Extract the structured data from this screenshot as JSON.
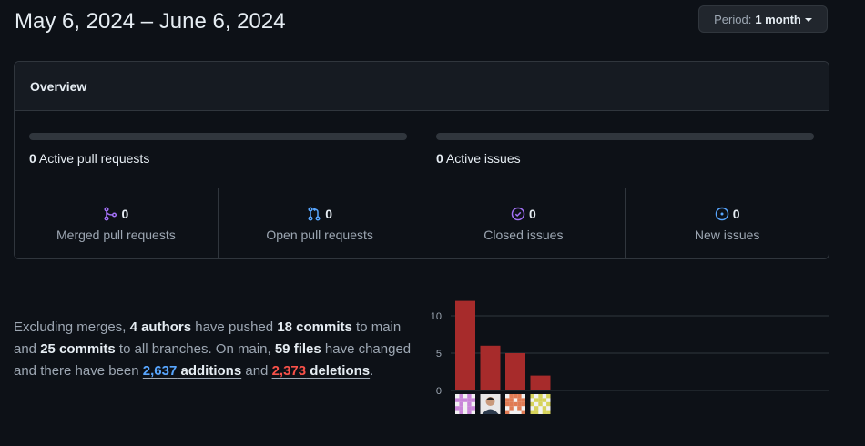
{
  "header": {
    "date_range": "May 6, 2024 – June 6, 2024",
    "period_label": "Period:",
    "period_value": "1 month"
  },
  "overview": {
    "title": "Overview",
    "active_pull_requests": {
      "count": "0",
      "label": "Active pull requests",
      "fill_fraction": 0
    },
    "active_issues": {
      "count": "0",
      "label": "Active issues",
      "fill_fraction": 0
    },
    "stats": [
      {
        "count": "0",
        "label": "Merged pull requests",
        "icon": "git-merge-icon",
        "color": "#a371f7"
      },
      {
        "count": "0",
        "label": "Open pull requests",
        "icon": "git-pull-request-icon",
        "color": "#58a6ff"
      },
      {
        "count": "0",
        "label": "Closed issues",
        "icon": "issue-closed-icon",
        "color": "#a371f7"
      },
      {
        "count": "0",
        "label": "New issues",
        "icon": "issue-opened-icon",
        "color": "#58a6ff"
      }
    ]
  },
  "summary": {
    "t1": "Excluding merges, ",
    "authors": "4 authors",
    "t2": " have pushed ",
    "commits_main": "18 commits",
    "t3": " to main and ",
    "commits_all": "25 commits",
    "t4": " to all branches. On main, ",
    "files": "59 files",
    "t5": " have changed and there have been ",
    "additions_num": "2,637",
    "additions_word": " additions",
    "t6": " and ",
    "deletions_num": "2,373",
    "deletions_word": " deletions",
    "t7": "."
  },
  "chart_data": {
    "type": "bar",
    "categories": [
      "author-1",
      "author-2",
      "author-3",
      "author-4"
    ],
    "values": [
      12,
      6,
      5,
      2
    ],
    "yticks": [
      0,
      5,
      10
    ],
    "ylim": [
      0,
      13
    ],
    "bar_color": "#a72b2b",
    "grid": true,
    "avatar_colors": [
      "#c986d9",
      "#2d3b4d",
      "#e07b54",
      "#d6d35a"
    ]
  }
}
